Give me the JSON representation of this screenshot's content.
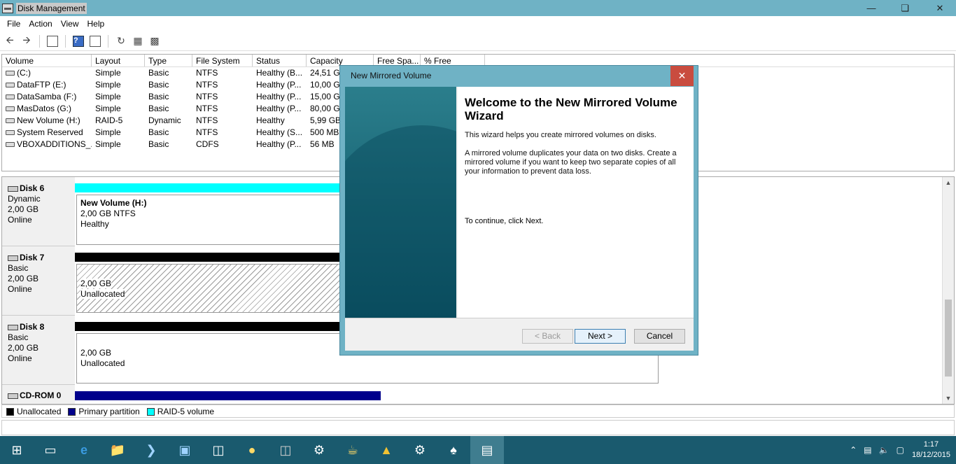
{
  "window": {
    "title": "Disk Management"
  },
  "menu": [
    "File",
    "Action",
    "View",
    "Help"
  ],
  "volume_list": {
    "columns": [
      "Volume",
      "Layout",
      "Type",
      "File System",
      "Status",
      "Capacity",
      "Free Spa...",
      "% Free"
    ],
    "rows": [
      [
        "(C:)",
        "Simple",
        "Basic",
        "NTFS",
        "Healthy (B...",
        "24,51 GB"
      ],
      [
        "DataFTP (E:)",
        "Simple",
        "Basic",
        "NTFS",
        "Healthy (P...",
        "10,00 GB"
      ],
      [
        "DataSamba (F:)",
        "Simple",
        "Basic",
        "NTFS",
        "Healthy (P...",
        "15,00 GB"
      ],
      [
        "MasDatos (G:)",
        "Simple",
        "Basic",
        "NTFS",
        "Healthy (P...",
        "80,00 GB"
      ],
      [
        "New Volume (H:)",
        "RAID-5",
        "Dynamic",
        "NTFS",
        "Healthy",
        "5,99 GB"
      ],
      [
        "System Reserved",
        "Simple",
        "Basic",
        "NTFS",
        "Healthy (S...",
        "500 MB"
      ],
      [
        "VBOXADDITIONS_...",
        "Simple",
        "Basic",
        "CDFS",
        "Healthy (P...",
        "56 MB"
      ]
    ]
  },
  "disks": [
    {
      "name": "Disk 6",
      "type": "Dynamic",
      "size": "2,00 GB",
      "state": "Online",
      "part_title": "New Volume  (H:)",
      "part_line1": "2,00 GB NTFS",
      "part_line2": "Healthy"
    },
    {
      "name": "Disk 7",
      "type": "Basic",
      "size": "2,00 GB",
      "state": "Online",
      "part_line1": "2,00 GB",
      "part_line2": "Unallocated"
    },
    {
      "name": "Disk 8",
      "type": "Basic",
      "size": "2,00 GB",
      "state": "Online",
      "part_line1": "2,00 GB",
      "part_line2": "Unallocated"
    },
    {
      "name": "CD-ROM 0"
    }
  ],
  "legend": [
    {
      "label": "Unallocated",
      "color": "#000000"
    },
    {
      "label": "Primary partition",
      "color": "#00008b"
    },
    {
      "label": "RAID-5 volume",
      "color": "#00ffff"
    }
  ],
  "dialog": {
    "title": "New Mirrored Volume",
    "heading": "Welcome to the New Mirrored Volume Wizard",
    "para1": "This wizard helps you create mirrored volumes on disks.",
    "para2": "A mirrored volume duplicates your data on two disks. Create a mirrored volume if you want to keep two separate copies of all your information to prevent  data loss.",
    "continue_text": "To continue, click Next.",
    "back_label": "< Back",
    "next_label": "Next >",
    "cancel_label": "Cancel"
  },
  "clock": {
    "time": "1:17",
    "date": "18/12/2015"
  }
}
